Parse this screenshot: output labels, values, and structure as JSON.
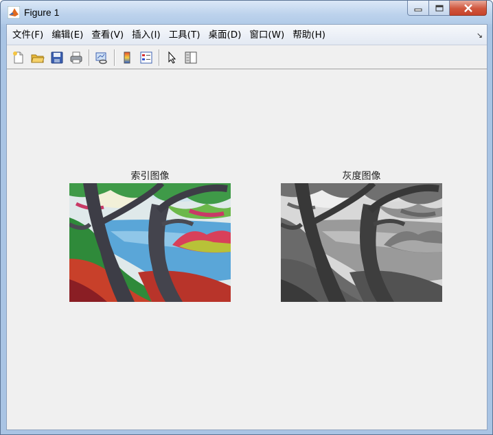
{
  "window": {
    "title": "Figure 1"
  },
  "menubar": {
    "items": [
      {
        "label": "文件(F)",
        "name": "menu-file"
      },
      {
        "label": "编辑(E)",
        "name": "menu-edit"
      },
      {
        "label": "查看(V)",
        "name": "menu-view"
      },
      {
        "label": "插入(I)",
        "name": "menu-insert"
      },
      {
        "label": "工具(T)",
        "name": "menu-tools"
      },
      {
        "label": "桌面(D)",
        "name": "menu-desktop"
      },
      {
        "label": "窗口(W)",
        "name": "menu-window"
      },
      {
        "label": "帮助(H)",
        "name": "menu-help"
      }
    ]
  },
  "toolbar": {
    "icons": [
      "new-figure-icon",
      "open-file-icon",
      "save-icon",
      "print-icon",
      "link-plot-icon",
      "colorbar-icon",
      "legend-icon",
      "edit-plot-pointer-icon",
      "property-inspector-icon"
    ]
  },
  "axes": {
    "left_title": "索引图像",
    "right_title": "灰度图像"
  },
  "colors": {
    "menubar_bg": "#e3e9f3",
    "client_bg": "#f0f0f0",
    "close_button": "#c7422a"
  }
}
